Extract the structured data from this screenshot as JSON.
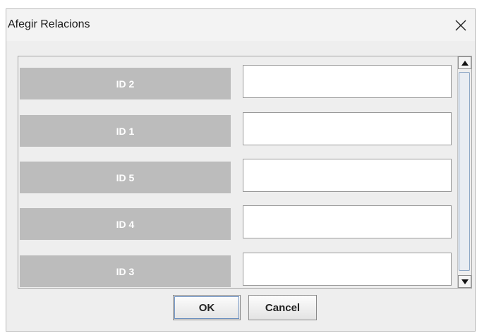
{
  "window": {
    "title": "Afegir Relacions",
    "close_icon": "close-icon"
  },
  "rows": [
    {
      "label": "ID 2",
      "value": ""
    },
    {
      "label": "ID 1",
      "value": ""
    },
    {
      "label": "ID 5",
      "value": ""
    },
    {
      "label": "ID 4",
      "value": ""
    },
    {
      "label": "ID 3",
      "value": ""
    }
  ],
  "scrollbar": {
    "up_icon": "arrow-up-icon",
    "down_icon": "arrow-down-icon"
  },
  "buttons": {
    "ok_label": "OK",
    "cancel_label": "Cancel"
  },
  "colors": {
    "label_bg": "#bcbcbc",
    "label_text": "#ffffff",
    "dialog_bg": "#eeeeee",
    "focus_ring": "#6b8fbf"
  }
}
